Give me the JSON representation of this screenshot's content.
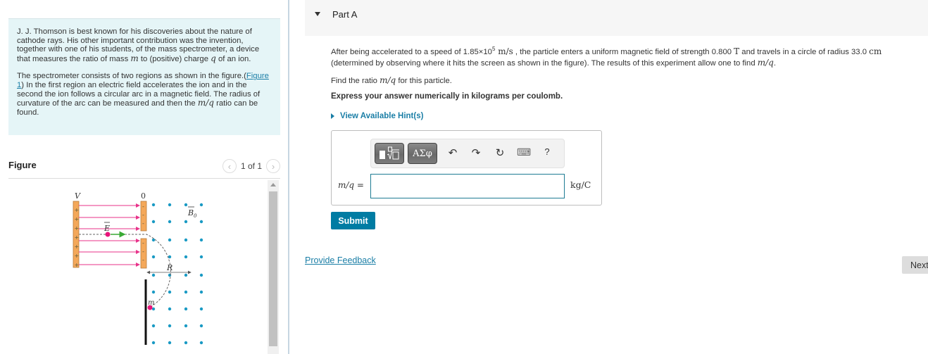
{
  "intro": {
    "para1_a": "J. J. Thomson is best known for his discoveries about the nature of cathode rays. His other important contribution was the invention, together with one of his students, of the mass spectrometer, a device that measures the ratio of mass ",
    "para1_m": "m",
    "para1_b": " to (positive) charge ",
    "para1_q": "q",
    "para1_c": " of an ion.",
    "para2_a": "The spectrometer consists of two regions as shown in the figure.(",
    "para2_link": "Figure 1",
    "para2_b": ") In the first region an electric field accelerates the ion and in the second the ion follows a circular arc in a magnetic field. The radius of curvature of the arc can be measured and then the ",
    "para2_mq": "m/q",
    "para2_c": " ratio can be found."
  },
  "figure": {
    "title": "Figure",
    "pager_text": "1 of 1",
    "prev_icon": "chevron-left-icon",
    "next_icon": "chevron-right-icon",
    "labels": {
      "V": "V",
      "zero": "0",
      "E": "E",
      "B": "B",
      "B_sub": "0",
      "R": "R",
      "m": "m",
      "plus": "+",
      "minus": "-"
    },
    "colors": {
      "plate": "#f4a85a",
      "plate_border": "#b87a3a",
      "field_line": "#e8338a",
      "particle": "#e8147a",
      "velocity_arrow": "#3aaa35",
      "b_dot": "#1a9ac4",
      "path": "#666666",
      "screen": "#111111"
    }
  },
  "part": {
    "title": "Part A",
    "problem_a": "After being accelerated to a speed of 1.85×10",
    "problem_exp": "5",
    "problem_unit1": " m/s",
    "problem_b": " , the particle enters a uniform magnetic field of strength 0.800 ",
    "problem_T": "T",
    "problem_c": " and travels in a circle of radius 33.0 ",
    "problem_cm": "cm",
    "problem_d": " (determined by observing where it hits the screen as shown in the figure). The results of this experiment allow one to find ",
    "problem_mq": "m/q",
    "problem_e": ".",
    "find_a": "Find the ratio ",
    "find_mq": "m/q",
    "find_b": " for this particle.",
    "express": "Express your answer numerically in kilograms per coulomb.",
    "hints": "View Available Hint(s)"
  },
  "answer": {
    "toolbar": {
      "templates_label": "▮∜▯",
      "symbols_label": "ΑΣφ",
      "undo_icon": "↶",
      "redo_icon": "↷",
      "reset_icon": "↻",
      "keyboard_icon": "⌨",
      "help_label": "?"
    },
    "label": "m/q =",
    "value": "",
    "placeholder": "",
    "unit": "kg/C"
  },
  "buttons": {
    "submit": "Submit",
    "feedback": "Provide Feedback",
    "next": "Next"
  }
}
